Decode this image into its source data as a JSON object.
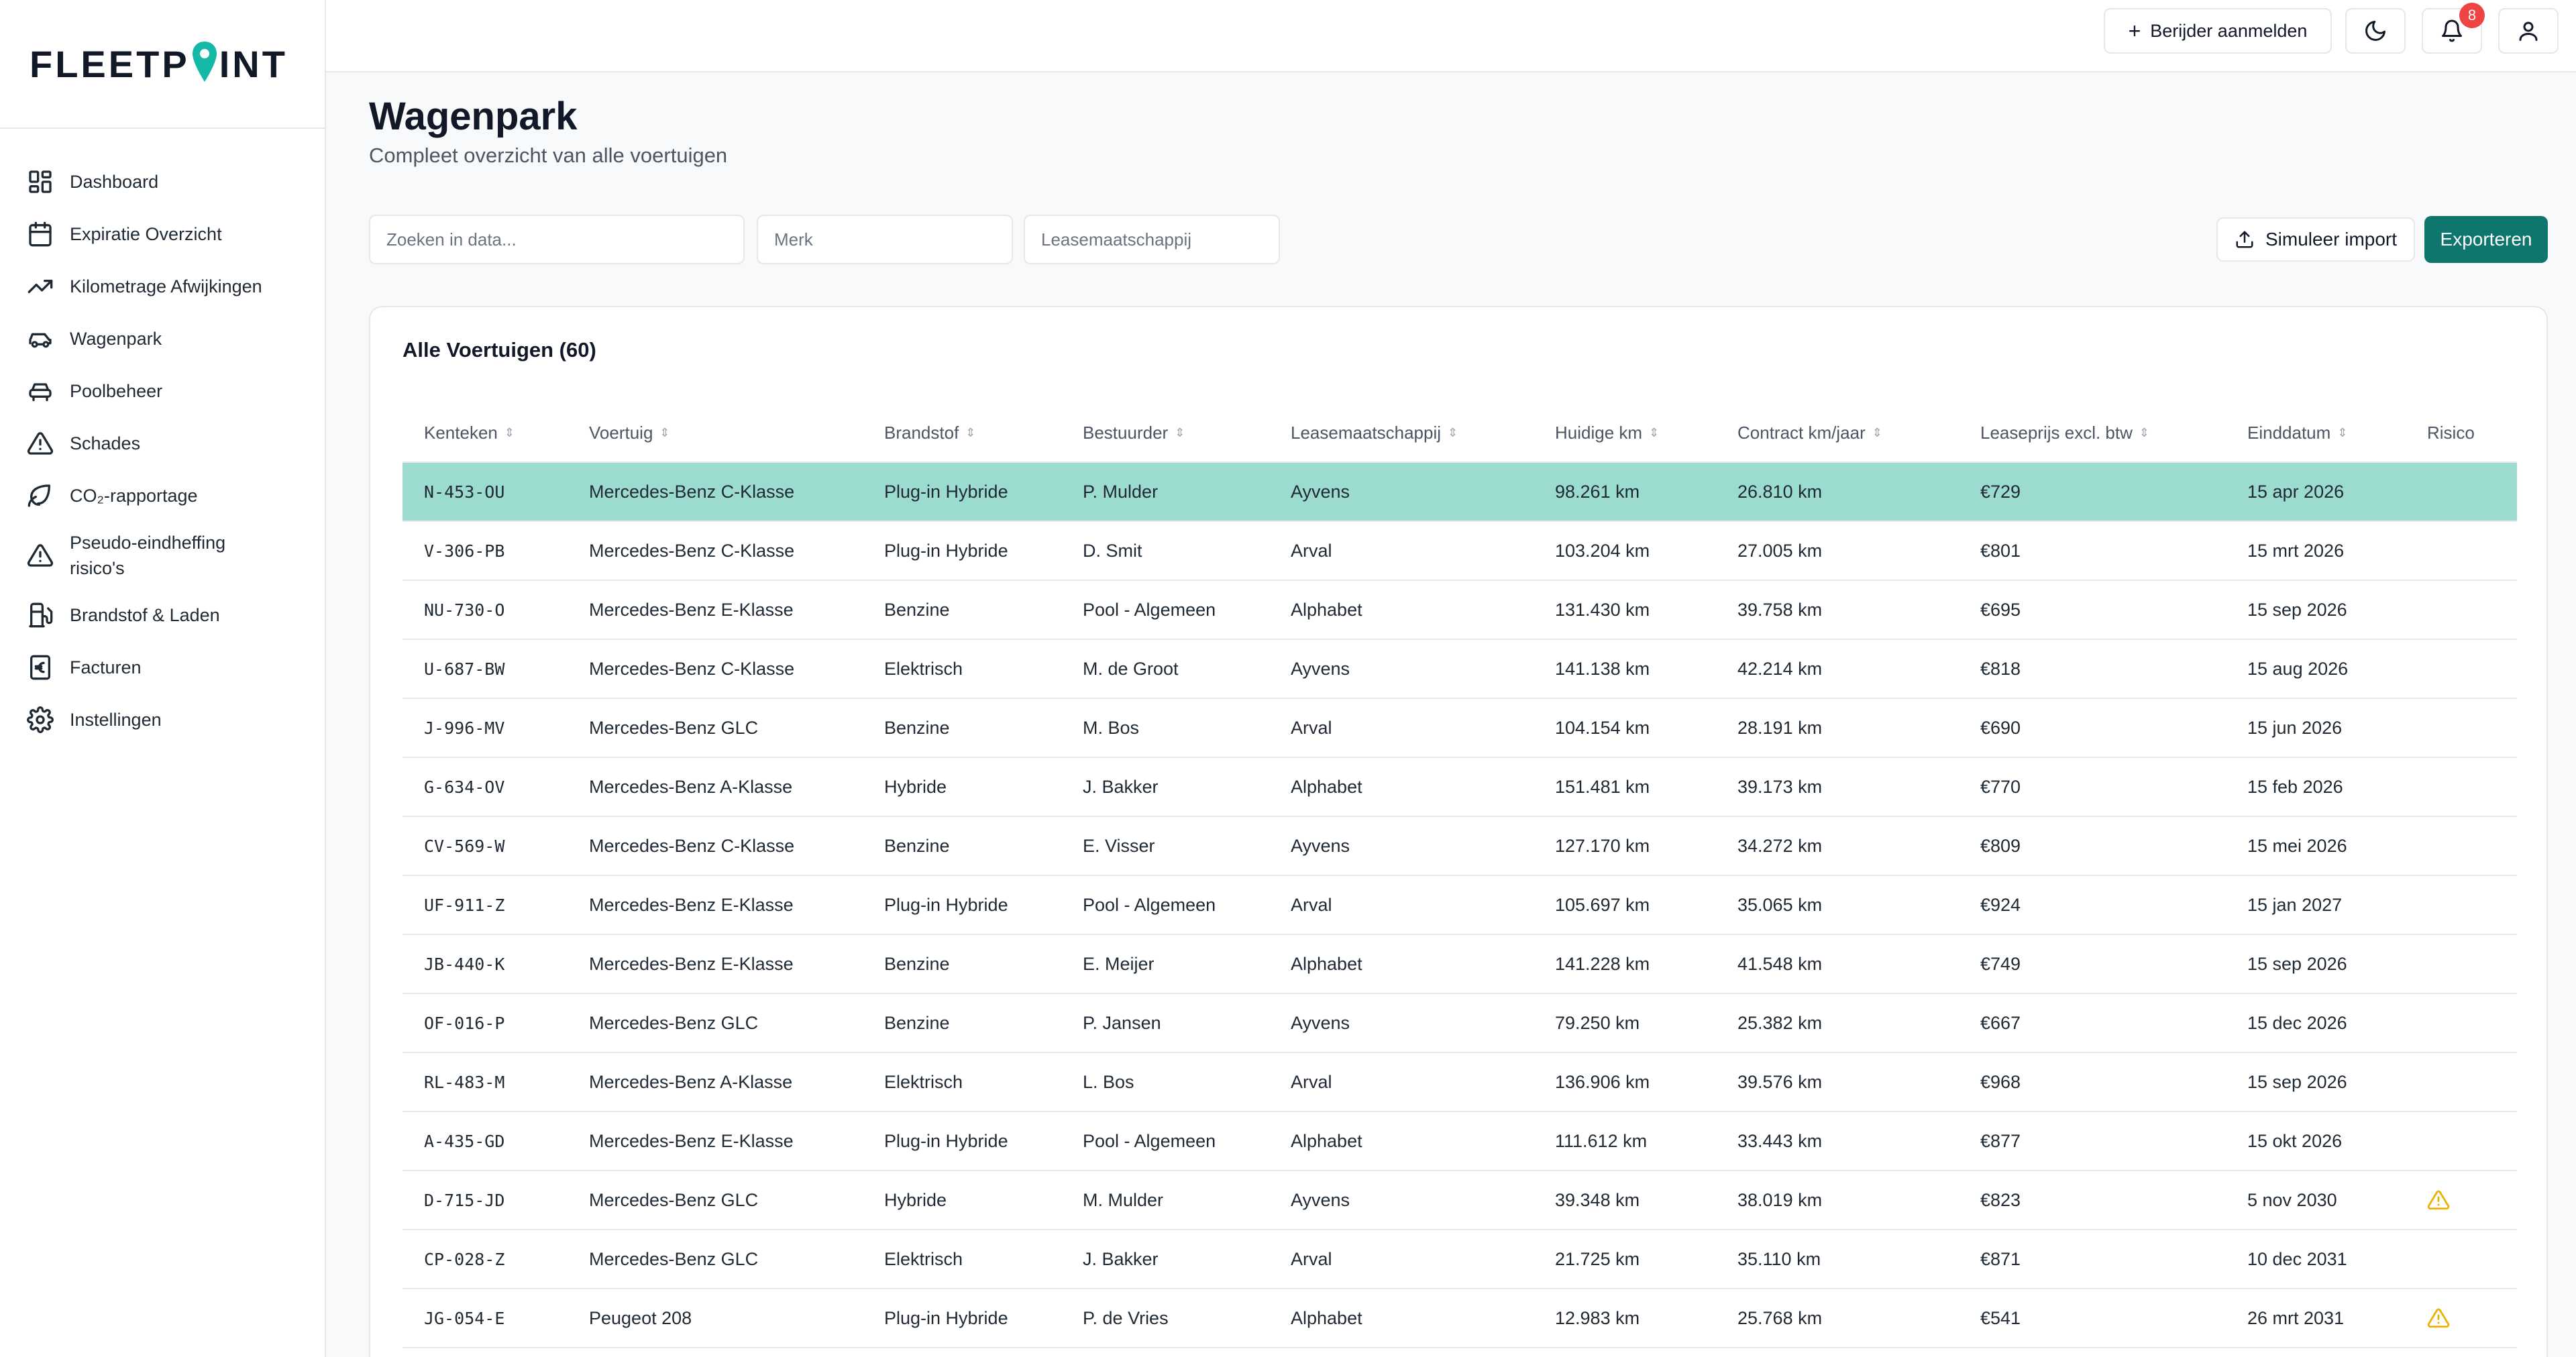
{
  "brand": {
    "name_left": "FLEETP",
    "name_right": "INT",
    "accent": "#14b8a6"
  },
  "nav": [
    {
      "label": "Dashboard",
      "icon": "dashboard-icon"
    },
    {
      "label": "Expiratie Overzicht",
      "icon": "calendar-icon"
    },
    {
      "label": "Kilometrage Afwijkingen",
      "icon": "trending-up-icon"
    },
    {
      "label": "Wagenpark",
      "icon": "car-icon"
    },
    {
      "label": "Poolbeheer",
      "icon": "car-front-icon"
    },
    {
      "label": "Schades",
      "icon": "warning-icon"
    },
    {
      "label": "CO₂-rapportage",
      "icon": "leaf-icon"
    },
    {
      "label": "Pseudo-eindheffing risico's",
      "icon": "warning-icon"
    },
    {
      "label": "Brandstof & Laden",
      "icon": "fuel-icon"
    },
    {
      "label": "Facturen",
      "icon": "euro-receipt-icon"
    },
    {
      "label": "Instellingen",
      "icon": "gear-icon"
    }
  ],
  "topbar": {
    "add_driver_label": "Berijder aanmelden",
    "notification_count": "8"
  },
  "page": {
    "title": "Wagenpark",
    "subtitle": "Compleet overzicht van alle voertuigen"
  },
  "filters": {
    "search_placeholder": "Zoeken in data...",
    "brand_placeholder": "Merk",
    "lease_placeholder": "Leasemaatschappij",
    "simulate_label": "Simuleer import",
    "export_label": "Exporteren"
  },
  "colors": {
    "primary": "#0f766e",
    "selected_row": "#9cdbcf",
    "warning": "#eab308",
    "badge": "#ef4444"
  },
  "table": {
    "title": "Alle Voertuigen (60)",
    "columns": [
      "Kenteken",
      "Voertuig",
      "Brandstof",
      "Bestuurder",
      "Leasemaatschappij",
      "Huidige km",
      "Contract km/jaar",
      "Leaseprijs excl. btw",
      "Einddatum",
      "Risico"
    ],
    "rows": [
      {
        "plate": "N-453-OU",
        "vehicle": "Mercedes-Benz C-Klasse",
        "fuel": "Plug-in Hybride",
        "driver": "P. Mulder",
        "lease": "Ayvens",
        "km": "98.261 km",
        "contract": "26.810 km",
        "price": "€729",
        "end": "15 apr 2026",
        "risk": false,
        "selected": true
      },
      {
        "plate": "V-306-PB",
        "vehicle": "Mercedes-Benz C-Klasse",
        "fuel": "Plug-in Hybride",
        "driver": "D. Smit",
        "lease": "Arval",
        "km": "103.204 km",
        "contract": "27.005 km",
        "price": "€801",
        "end": "15 mrt 2026",
        "risk": false
      },
      {
        "plate": "NU-730-O",
        "vehicle": "Mercedes-Benz E-Klasse",
        "fuel": "Benzine",
        "driver": "Pool - Algemeen",
        "lease": "Alphabet",
        "km": "131.430 km",
        "contract": "39.758 km",
        "price": "€695",
        "end": "15 sep 2026",
        "risk": false
      },
      {
        "plate": "U-687-BW",
        "vehicle": "Mercedes-Benz C-Klasse",
        "fuel": "Elektrisch",
        "driver": "M. de Groot",
        "lease": "Ayvens",
        "km": "141.138 km",
        "contract": "42.214 km",
        "price": "€818",
        "end": "15 aug 2026",
        "risk": false
      },
      {
        "plate": "J-996-MV",
        "vehicle": "Mercedes-Benz GLC",
        "fuel": "Benzine",
        "driver": "M. Bos",
        "lease": "Arval",
        "km": "104.154 km",
        "contract": "28.191 km",
        "price": "€690",
        "end": "15 jun 2026",
        "risk": false
      },
      {
        "plate": "G-634-OV",
        "vehicle": "Mercedes-Benz A-Klasse",
        "fuel": "Hybride",
        "driver": "J. Bakker",
        "lease": "Alphabet",
        "km": "151.481 km",
        "contract": "39.173 km",
        "price": "€770",
        "end": "15 feb 2026",
        "risk": false
      },
      {
        "plate": "CV-569-W",
        "vehicle": "Mercedes-Benz C-Klasse",
        "fuel": "Benzine",
        "driver": "E. Visser",
        "lease": "Ayvens",
        "km": "127.170 km",
        "contract": "34.272 km",
        "price": "€809",
        "end": "15 mei 2026",
        "risk": false
      },
      {
        "plate": "UF-911-Z",
        "vehicle": "Mercedes-Benz E-Klasse",
        "fuel": "Plug-in Hybride",
        "driver": "Pool - Algemeen",
        "lease": "Arval",
        "km": "105.697 km",
        "contract": "35.065 km",
        "price": "€924",
        "end": "15 jan 2027",
        "risk": false
      },
      {
        "plate": "JB-440-K",
        "vehicle": "Mercedes-Benz E-Klasse",
        "fuel": "Benzine",
        "driver": "E. Meijer",
        "lease": "Alphabet",
        "km": "141.228 km",
        "contract": "41.548 km",
        "price": "€749",
        "end": "15 sep 2026",
        "risk": false
      },
      {
        "plate": "OF-016-P",
        "vehicle": "Mercedes-Benz GLC",
        "fuel": "Benzine",
        "driver": "P. Jansen",
        "lease": "Ayvens",
        "km": "79.250 km",
        "contract": "25.382 km",
        "price": "€667",
        "end": "15 dec 2026",
        "risk": false
      },
      {
        "plate": "RL-483-M",
        "vehicle": "Mercedes-Benz A-Klasse",
        "fuel": "Elektrisch",
        "driver": "L. Bos",
        "lease": "Arval",
        "km": "136.906 km",
        "contract": "39.576 km",
        "price": "€968",
        "end": "15 sep 2026",
        "risk": false
      },
      {
        "plate": "A-435-GD",
        "vehicle": "Mercedes-Benz E-Klasse",
        "fuel": "Plug-in Hybride",
        "driver": "Pool - Algemeen",
        "lease": "Alphabet",
        "km": "111.612 km",
        "contract": "33.443 km",
        "price": "€877",
        "end": "15 okt 2026",
        "risk": false
      },
      {
        "plate": "D-715-JD",
        "vehicle": "Mercedes-Benz GLC",
        "fuel": "Hybride",
        "driver": "M. Mulder",
        "lease": "Ayvens",
        "km": "39.348 km",
        "contract": "38.019 km",
        "price": "€823",
        "end": "5 nov 2030",
        "risk": true
      },
      {
        "plate": "CP-028-Z",
        "vehicle": "Mercedes-Benz GLC",
        "fuel": "Elektrisch",
        "driver": "J. Bakker",
        "lease": "Arval",
        "km": "21.725 km",
        "contract": "35.110 km",
        "price": "€871",
        "end": "10 dec 2031",
        "risk": false
      },
      {
        "plate": "JG-054-E",
        "vehicle": "Peugeot 208",
        "fuel": "Plug-in Hybride",
        "driver": "P. de Vries",
        "lease": "Alphabet",
        "km": "12.983 km",
        "contract": "25.768 km",
        "price": "€541",
        "end": "26 mrt 2031",
        "risk": true
      }
    ]
  }
}
